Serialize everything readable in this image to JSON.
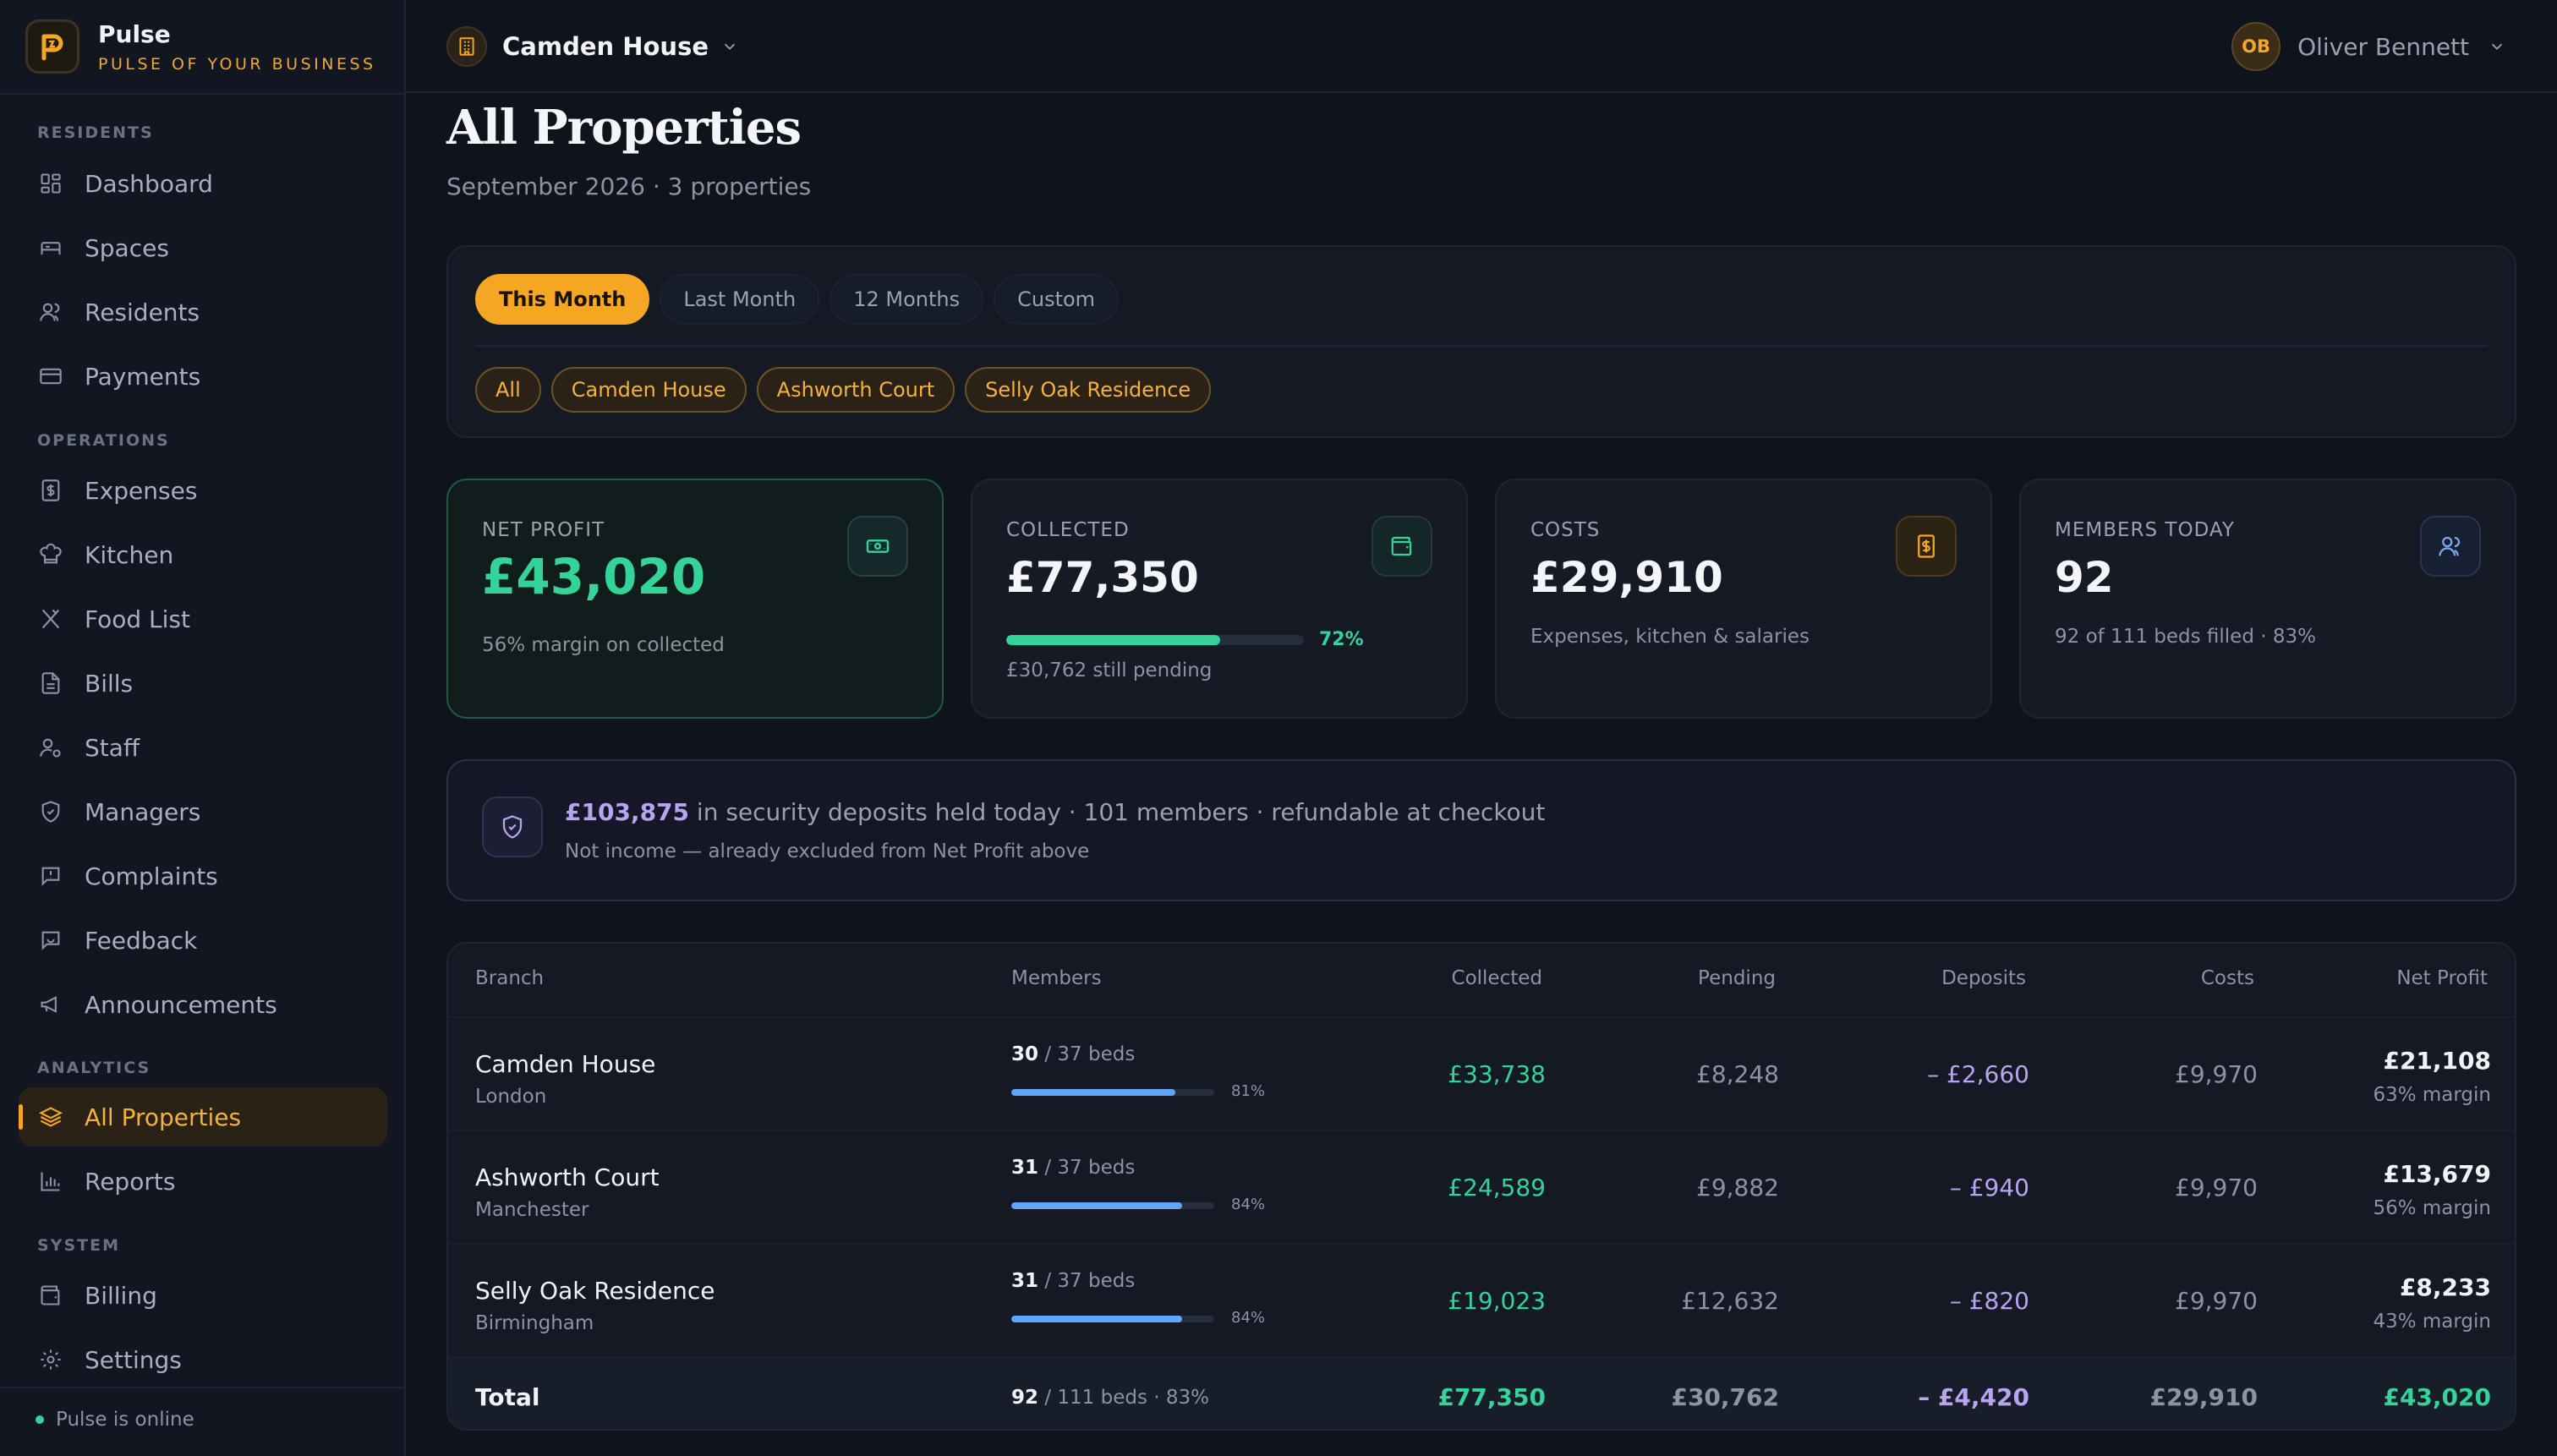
{
  "brand": {
    "name": "Pulse",
    "tagline": "PULSE OF YOUR BUSINESS"
  },
  "sidebar": {
    "sections": [
      {
        "title": "RESIDENTS",
        "items": [
          {
            "label": "Dashboard",
            "icon": "dashboard-icon"
          },
          {
            "label": "Spaces",
            "icon": "bed-icon"
          },
          {
            "label": "Residents",
            "icon": "users-icon"
          },
          {
            "label": "Payments",
            "icon": "credit-card-icon"
          }
        ]
      },
      {
        "title": "OPERATIONS",
        "items": [
          {
            "label": "Expenses",
            "icon": "receipt-icon"
          },
          {
            "label": "Kitchen",
            "icon": "chef-hat-icon"
          },
          {
            "label": "Food List",
            "icon": "utensils-icon"
          },
          {
            "label": "Bills",
            "icon": "file-icon"
          },
          {
            "label": "Staff",
            "icon": "user-cog-icon"
          },
          {
            "label": "Managers",
            "icon": "shield-icon"
          },
          {
            "label": "Complaints",
            "icon": "message-alert-icon"
          },
          {
            "label": "Feedback",
            "icon": "message-smile-icon"
          },
          {
            "label": "Announcements",
            "icon": "megaphone-icon"
          }
        ]
      },
      {
        "title": "ANALYTICS",
        "items": [
          {
            "label": "All Properties",
            "icon": "layers-icon",
            "active": true
          },
          {
            "label": "Reports",
            "icon": "bar-chart-icon"
          }
        ]
      },
      {
        "title": "SYSTEM",
        "items": [
          {
            "label": "Billing",
            "icon": "wallet-icon"
          },
          {
            "label": "Settings",
            "icon": "gear-icon"
          }
        ]
      }
    ],
    "status": "Pulse is online"
  },
  "topbar": {
    "property": "Camden House",
    "user_initials": "OB",
    "user_name": "Oliver Bennett"
  },
  "page": {
    "title": "All Properties",
    "subtitle": "September 2026 · 3 properties"
  },
  "filters": {
    "periods": [
      "This Month",
      "Last Month",
      "12 Months",
      "Custom"
    ],
    "active_period": "This Month",
    "properties": [
      "All",
      "Camden House",
      "Ashworth Court",
      "Selly Oak Residence"
    ]
  },
  "cards": {
    "net_profit": {
      "label": "NET PROFIT",
      "value": "£43,020",
      "note": "56% margin on collected"
    },
    "collected": {
      "label": "COLLECTED",
      "value": "£77,350",
      "progress": 0.72,
      "progress_label": "72%",
      "note": "£30,762 still pending"
    },
    "costs": {
      "label": "COSTS",
      "value": "£29,910",
      "note": "Expenses, kitchen & salaries"
    },
    "members": {
      "label": "MEMBERS TODAY",
      "value": "92",
      "note": "92 of 111 beds filled · 83%"
    }
  },
  "deposit": {
    "amount": "£103,875",
    "text": " in security deposits held today · 101 members · refundable at checkout",
    "note": "Not income — already excluded from Net Profit above"
  },
  "table": {
    "headers": [
      "Branch",
      "Members",
      "Collected",
      "Pending",
      "Deposits",
      "Costs",
      "Net Profit"
    ],
    "rows": [
      {
        "name": "Camden House",
        "city": "London",
        "members": "30",
        "beds": " / 37 beds",
        "occupancy": 0.81,
        "occupancy_label": "81%",
        "collected": "£33,738",
        "pending": "£8,248",
        "deposits": "– £2,660",
        "costs": "£9,970",
        "net": "£21,108",
        "margin": "63% margin"
      },
      {
        "name": "Ashworth Court",
        "city": "Manchester",
        "members": "31",
        "beds": " / 37 beds",
        "occupancy": 0.84,
        "occupancy_label": "84%",
        "collected": "£24,589",
        "pending": "£9,882",
        "deposits": "– £940",
        "costs": "£9,970",
        "net": "£13,679",
        "margin": "56% margin"
      },
      {
        "name": "Selly Oak Residence",
        "city": "Birmingham",
        "members": "31",
        "beds": " / 37 beds",
        "occupancy": 0.84,
        "occupancy_label": "84%",
        "collected": "£19,023",
        "pending": "£12,632",
        "deposits": "– £820",
        "costs": "£9,970",
        "net": "£8,233",
        "margin": "43% margin"
      }
    ],
    "total": {
      "name": "Total",
      "members": "92",
      "beds": " / 111 beds · 83%",
      "collected": "£77,350",
      "pending": "£30,762",
      "deposits": "– £4,420",
      "costs": "£29,910",
      "net": "£43,020"
    }
  },
  "colors": {
    "accent": "#f5a623",
    "positive": "#34d399",
    "deposit": "#b8a4f0",
    "occupancy": "#60a5fa"
  }
}
